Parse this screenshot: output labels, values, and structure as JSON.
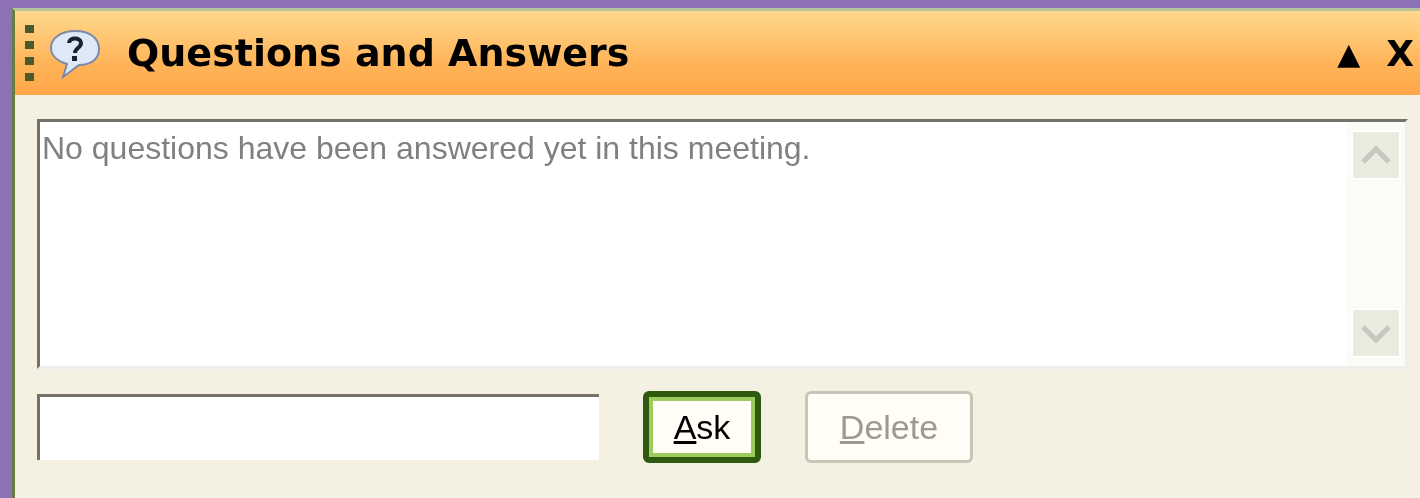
{
  "panel": {
    "title": "Questions and Answers",
    "collapse_glyph": "▲",
    "close_glyph": "X"
  },
  "answers": {
    "message": "No questions have been answered yet in this meeting."
  },
  "buttons": [
    {
      "label": "Ask",
      "disabled": false,
      "focused": true
    },
    {
      "label": "Delete",
      "disabled": true,
      "focused": false
    }
  ]
}
